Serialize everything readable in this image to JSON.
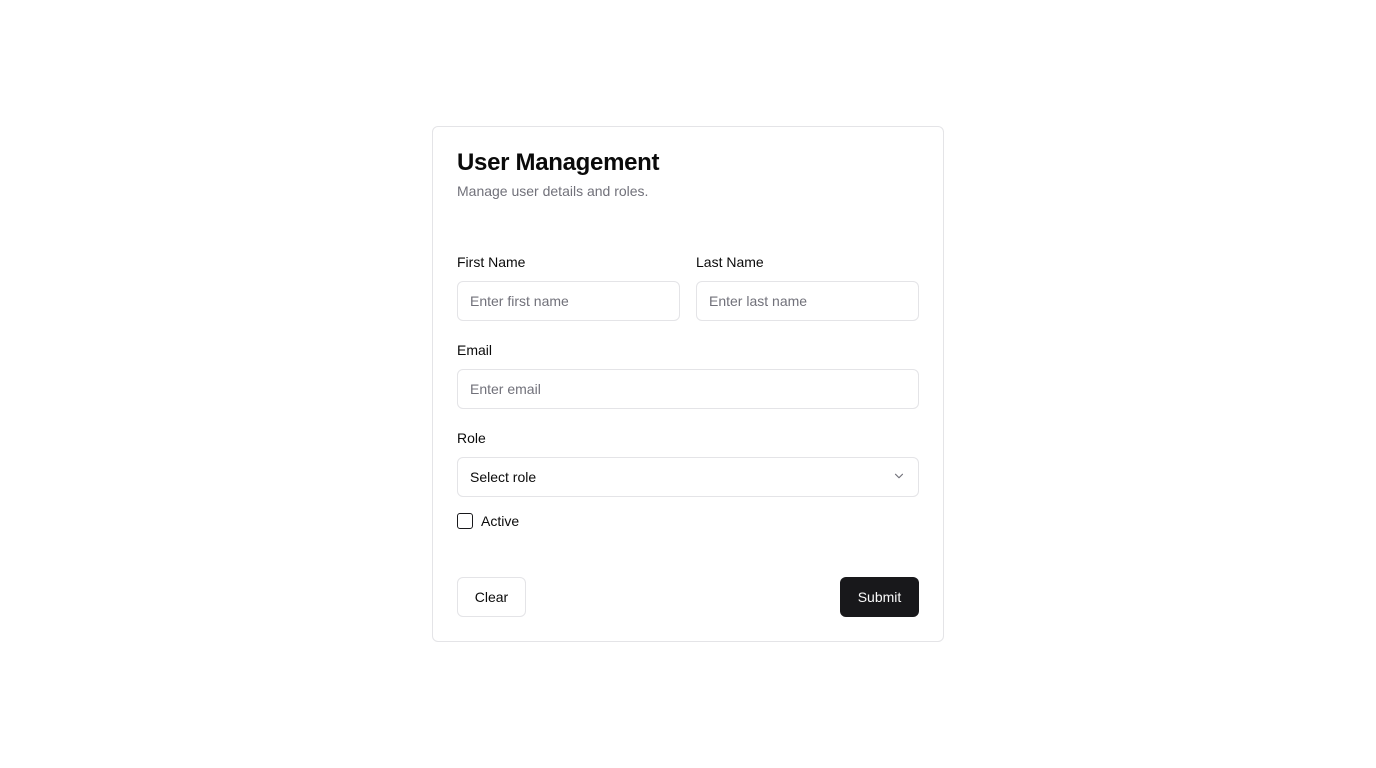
{
  "form": {
    "title": "User Management",
    "subtitle": "Manage user details and roles.",
    "first_name": {
      "label": "First Name",
      "value": "",
      "placeholder": "Enter first name"
    },
    "last_name": {
      "label": "Last Name",
      "value": "",
      "placeholder": "Enter last name"
    },
    "email": {
      "label": "Email",
      "value": "",
      "placeholder": "Enter email"
    },
    "role": {
      "label": "Role",
      "selected": "Select role",
      "icon": "chevron-down-icon"
    },
    "active": {
      "label": "Active",
      "checked": false
    },
    "buttons": {
      "clear_label": "Clear",
      "submit_label": "Submit"
    }
  },
  "colors": {
    "primary": "#18181b",
    "border": "#e4e4e7",
    "muted_text": "#71717a",
    "background": "#ffffff"
  }
}
